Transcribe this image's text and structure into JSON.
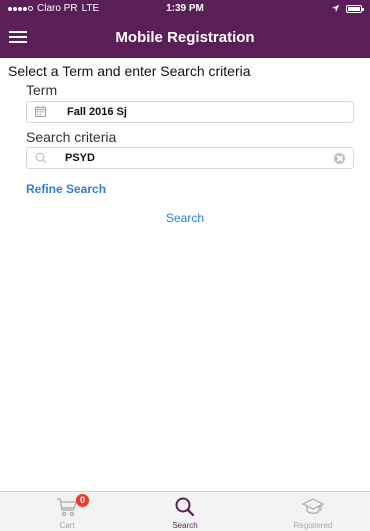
{
  "status_bar": {
    "carrier": "Claro PR",
    "network": "LTE",
    "time": "1:39 PM"
  },
  "nav": {
    "title": "Mobile Registration",
    "menu_icon": "hamburger-menu-icon"
  },
  "main": {
    "instruction": "Select a Term and enter Search criteria",
    "term": {
      "label": "Term",
      "value": "Fall 2016 Sj",
      "icon": "calendar-icon"
    },
    "search_criteria": {
      "label": "Search criteria",
      "value": "PSYD",
      "icon": "search-icon",
      "clear_icon": "clear-icon"
    },
    "refine_search_label": "Refine Search",
    "search_button_label": "Search"
  },
  "tab_bar": {
    "tabs": [
      {
        "label": "Cart",
        "icon": "cart-icon",
        "badge": "0",
        "active": false
      },
      {
        "label": "Search",
        "icon": "search-icon",
        "active": true
      },
      {
        "label": "Registered",
        "icon": "graduation-cap-icon",
        "active": false
      }
    ]
  },
  "colors": {
    "brand": "#5b1f57",
    "link": "#2f7fd6",
    "badge": "#ef3b2d",
    "inactive_tab": "#a8a8a8"
  }
}
